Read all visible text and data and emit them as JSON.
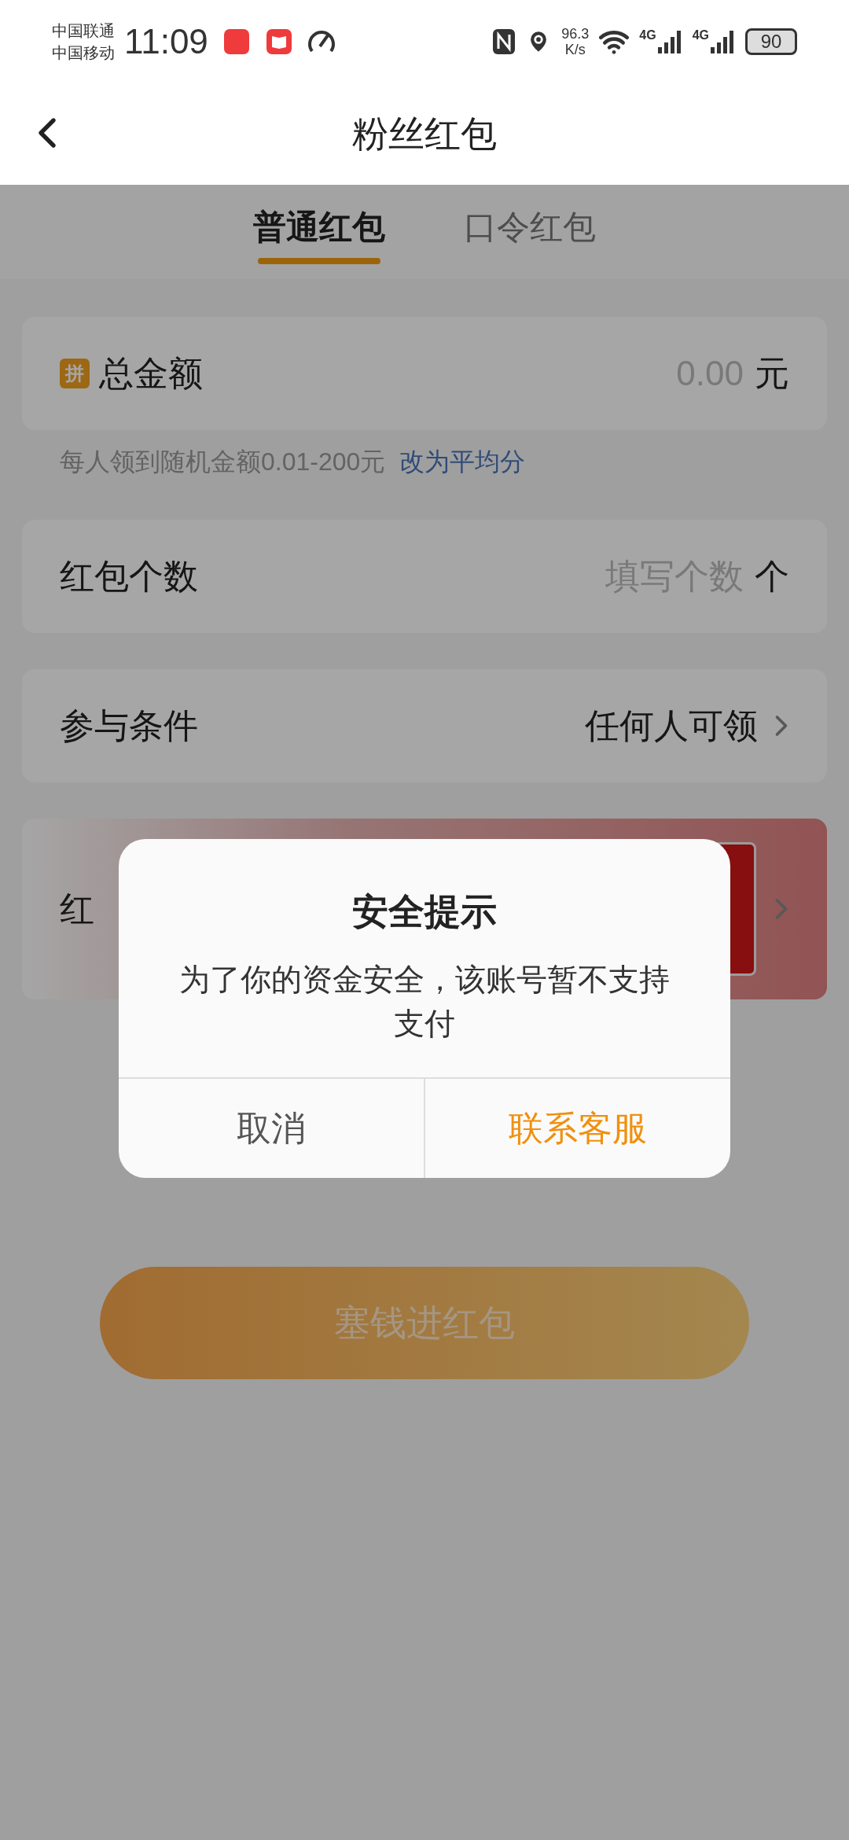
{
  "status_bar": {
    "carriers": [
      "中国联通",
      "中国移动"
    ],
    "time": "11:09",
    "speed_value": "96.3",
    "speed_unit": "K/s",
    "network_1": "4G",
    "network_2": "4G",
    "battery": "90"
  },
  "header": {
    "title": "粉丝红包"
  },
  "tabs": [
    {
      "label": "普通红包",
      "selected": true
    },
    {
      "label": "口令红包",
      "selected": false
    }
  ],
  "total_amount": {
    "badge": "拼",
    "label": "总金额",
    "value": "0.00",
    "unit": "元"
  },
  "hint": {
    "text": "每人领到随机金额0.01-200元",
    "link": "改为平均分"
  },
  "count_row": {
    "label": "红包个数",
    "placeholder": "填写个数",
    "unit": "个"
  },
  "condition_row": {
    "label": "参与条件",
    "value": "任何人可领"
  },
  "cover_row": {
    "label": "红"
  },
  "submit_button": {
    "label": "塞钱进红包"
  },
  "dialog": {
    "title": "安全提示",
    "message": "为了你的资金安全，该账号暂不支持支付",
    "buttons": [
      {
        "label": "取消",
        "kind": "secondary"
      },
      {
        "label": "联系客服",
        "kind": "primary"
      }
    ]
  }
}
